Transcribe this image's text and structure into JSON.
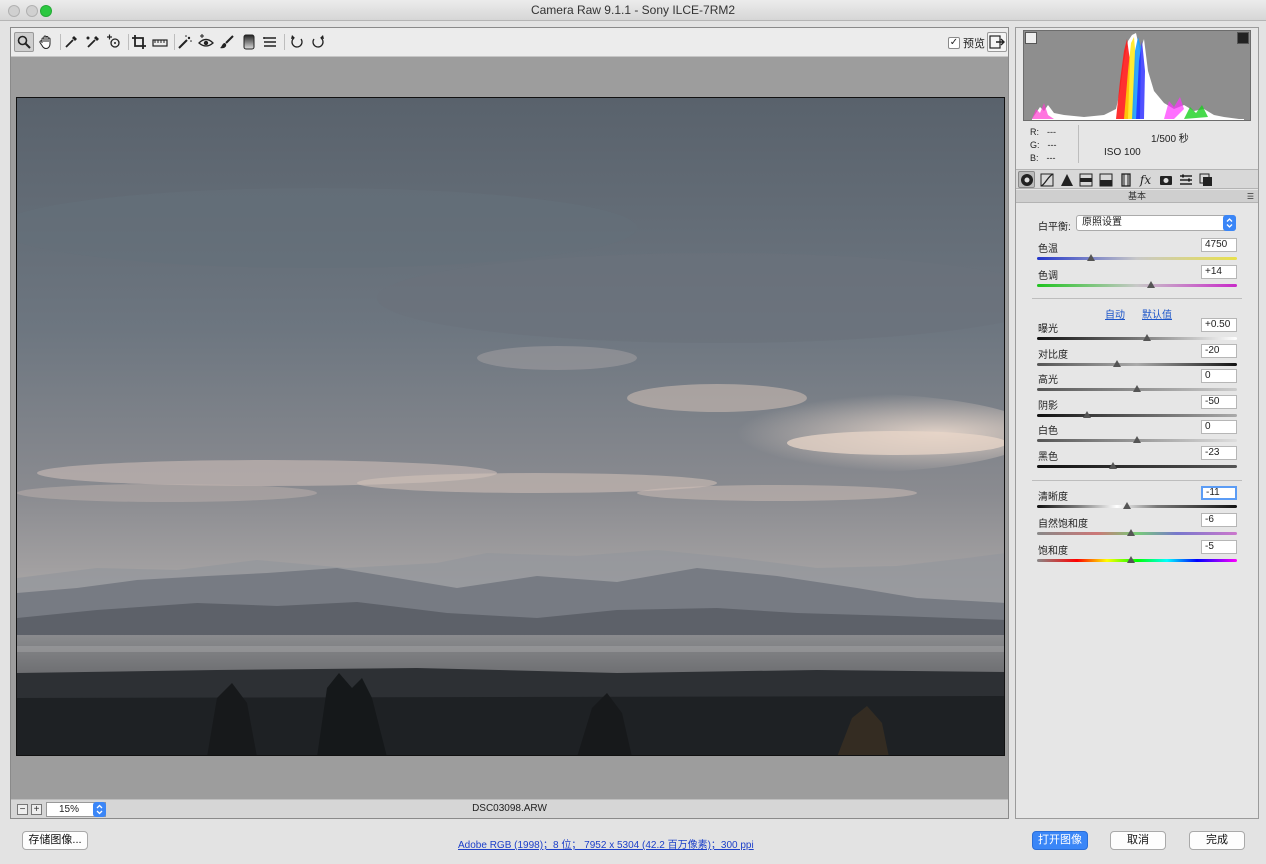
{
  "window": {
    "title": "Camera Raw 9.1.1 -  Sony ILCE-7RM2"
  },
  "toolbar": {
    "preview_label": "预览",
    "preview_checked": true,
    "tools": [
      "zoom-icon",
      "hand-icon",
      "white-balance-icon",
      "color-sampler-icon",
      "targeted-adjust-icon",
      "crop-icon",
      "straighten-icon",
      "spot-removal-icon",
      "red-eye-icon",
      "adjustment-brush-icon",
      "graduated-filter-icon",
      "radial-filter-icon",
      "preferences-icon",
      "rotate-ccw-icon",
      "rotate-cw-icon"
    ]
  },
  "status": {
    "zoom": "15%",
    "filename": "DSC03098.ARW"
  },
  "info": {
    "r_label": "R:",
    "r_value": "---",
    "g_label": "G:",
    "g_value": "---",
    "b_label": "B:",
    "b_value": "---",
    "shutter": "1/500 秒",
    "iso": "ISO 100"
  },
  "panel": {
    "title": "基本",
    "white_balance_label": "白平衡:",
    "white_balance_value": "原照设置",
    "auto_link": "自动",
    "default_link": "默认值",
    "sliders": [
      {
        "label": "色温",
        "value": "4750",
        "position": 0.27
      },
      {
        "label": "色调",
        "value": "+14",
        "position": 0.57
      },
      {
        "label": "曝光",
        "value": "+0.50",
        "position": 0.55
      },
      {
        "label": "对比度",
        "value": "-20",
        "position": 0.4
      },
      {
        "label": "高光",
        "value": "0",
        "position": 0.5
      },
      {
        "label": "阴影",
        "value": "-50",
        "position": 0.25
      },
      {
        "label": "白色",
        "value": "0",
        "position": 0.5
      },
      {
        "label": "黑色",
        "value": "-23",
        "position": 0.38
      },
      {
        "label": "清晰度",
        "value": "-11",
        "position": 0.45
      },
      {
        "label": "自然饱和度",
        "value": "-6",
        "position": 0.47
      },
      {
        "label": "饱和度",
        "value": "-5",
        "position": 0.47
      }
    ]
  },
  "footer": {
    "save_button": "存储图像...",
    "workflow_info": "Adobe RGB (1998)；8 位；  7952 x 5304 (42.2 百万像素)；300 ppi",
    "open_button": "打开图像",
    "cancel_button": "取消",
    "done_button": "完成"
  },
  "colors": {
    "accent": "#3a86f7",
    "link": "#1d56c9"
  }
}
